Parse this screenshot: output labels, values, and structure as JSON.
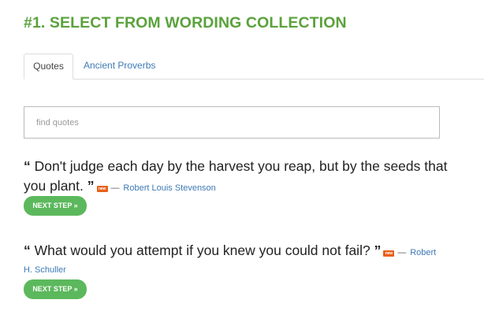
{
  "heading": "#1. SELECT FROM WORDING COLLECTION",
  "tabs": [
    {
      "label": "Quotes",
      "active": true
    },
    {
      "label": "Ancient Proverbs",
      "active": false
    }
  ],
  "search": {
    "placeholder": "find quotes",
    "value": ""
  },
  "quotes": [
    {
      "open_mark": "“",
      "text": "Don't judge each day by the harvest you reap, but by the seeds that you plant.",
      "close_mark": "”",
      "badge": "new",
      "dash": "—",
      "author": "Robert Louis Stevenson",
      "button_label": "NEXT STEP »"
    },
    {
      "open_mark": "“",
      "text": "What would you attempt if you knew you could not fail?",
      "close_mark": "”",
      "badge": "new",
      "dash": "—",
      "author_part1": "Robert",
      "author_part2": "H. Schuller",
      "button_label": "NEXT STEP »"
    }
  ],
  "colors": {
    "heading_green": "#5aa23c",
    "button_green": "#5cb85c",
    "link_blue": "#3d7ab5",
    "badge_orange": "#e8611a"
  }
}
